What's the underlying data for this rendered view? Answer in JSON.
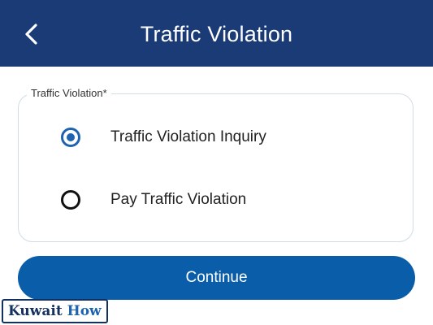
{
  "header": {
    "title": "Traffic Violation",
    "back_icon": "chevron-left-icon"
  },
  "form": {
    "group_label": "Traffic Violation*",
    "options": [
      {
        "label": "Traffic Violation Inquiry",
        "selected": true
      },
      {
        "label": "Pay Traffic Violation",
        "selected": false
      }
    ]
  },
  "actions": {
    "continue_label": "Continue"
  },
  "watermark": {
    "part1": "Kuwait",
    "part2": "How"
  },
  "colors": {
    "header_bg": "#1a3b75",
    "accent": "#0a5ea9",
    "radio_selected": "#1e63b0"
  }
}
